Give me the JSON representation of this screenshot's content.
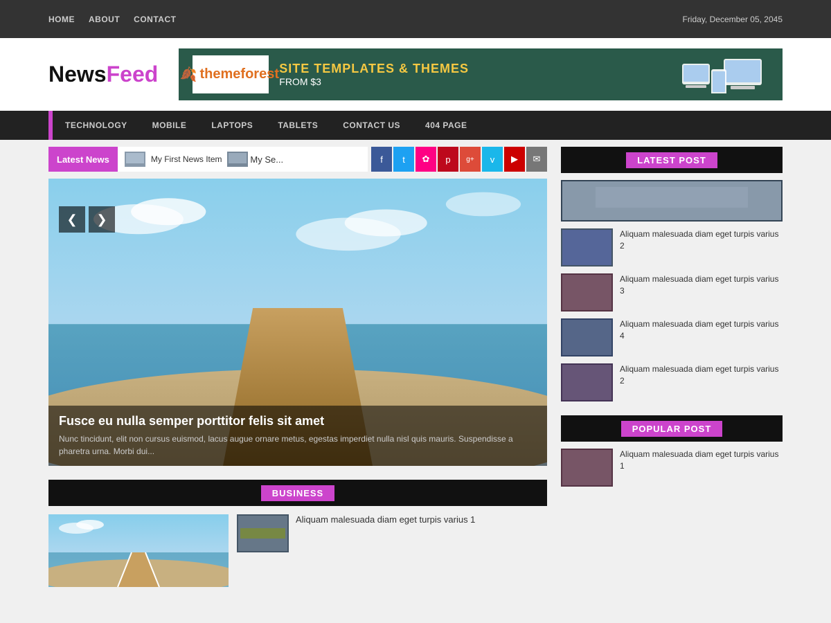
{
  "topbar": {
    "nav": [
      {
        "label": "HOME",
        "href": "#"
      },
      {
        "label": "ABOUT",
        "href": "#"
      },
      {
        "label": "CONTACT",
        "href": "#"
      }
    ],
    "date": "Friday, December 05, 2045"
  },
  "logo": {
    "news": "News",
    "feed": "Feed"
  },
  "banner": {
    "logo_symbol": "🍂",
    "logo_text": "themeforest",
    "line1": "SITE TEMPLATES & THEMES",
    "line2": "FROM $3"
  },
  "catnav": {
    "links": [
      {
        "label": "TECHNOLOGY"
      },
      {
        "label": "MOBILE"
      },
      {
        "label": "LAPTOPS"
      },
      {
        "label": "TABLETS"
      },
      {
        "label": "CONTACT US"
      },
      {
        "label": "404 PAGE"
      }
    ]
  },
  "latest_news": {
    "label": "Latest News",
    "ticker_text": "My First News Item",
    "ticker_text2": "My Se..."
  },
  "social": [
    {
      "name": "facebook",
      "symbol": "f",
      "cls": "soc-fb"
    },
    {
      "name": "twitter",
      "symbol": "t",
      "cls": "soc-tw"
    },
    {
      "name": "flickr",
      "symbol": "✿",
      "cls": "soc-fl"
    },
    {
      "name": "pinterest",
      "symbol": "p",
      "cls": "soc-pi"
    },
    {
      "name": "googleplus",
      "symbol": "g+",
      "cls": "soc-gp"
    },
    {
      "name": "vimeo",
      "symbol": "v",
      "cls": "soc-vi"
    },
    {
      "name": "youtube",
      "symbol": "▶",
      "cls": "soc-yt"
    },
    {
      "name": "email",
      "symbol": "✉",
      "cls": "soc-em"
    }
  ],
  "slider": {
    "prev_label": "❮",
    "next_label": "❯",
    "title": "Fusce eu nulla semper porttitor felis sit amet",
    "excerpt": "Nunc tincidunt, elit non cursus euismod, lacus augue ornare metus, egestas imperdiet nulla nisl quis mauris. Suspendisse a pharetra urna. Morbi dui..."
  },
  "business": {
    "label": "BUSINESS",
    "item_text": "Aliquam malesuada diam eget turpis varius 1"
  },
  "sidebar": {
    "latest_post": {
      "label": "LATEST POST",
      "items": [
        {
          "text": "Aliquam malesuada diam eget turpis varius 2",
          "thumb_cls": "t2"
        },
        {
          "text": "Aliquam malesuada diam eget turpis varius 3",
          "thumb_cls": "t3"
        },
        {
          "text": "Aliquam malesuada diam eget turpis varius 4",
          "thumb_cls": "t4"
        },
        {
          "text": "Aliquam malesuada diam eget turpis varius 2",
          "thumb_cls": "t5"
        }
      ]
    },
    "popular_post": {
      "label": "POPULAR POST",
      "items": [
        {
          "text": "Aliquam malesuada diam eget turpis varius 1",
          "thumb_cls": "t6"
        }
      ]
    }
  }
}
